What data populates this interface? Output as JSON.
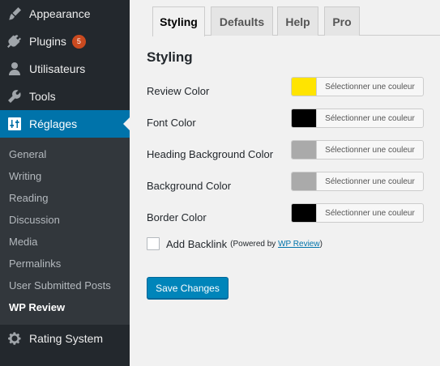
{
  "sidebar": {
    "menu_top": [
      {
        "label": "Appearance",
        "icon": "paintbrush-icon"
      },
      {
        "label": "Plugins",
        "icon": "plug-icon",
        "badge": "5"
      },
      {
        "label": "Utilisateurs",
        "icon": "user-icon"
      },
      {
        "label": "Tools",
        "icon": "wrench-icon"
      },
      {
        "label": "Réglages",
        "icon": "settings-sliders-icon"
      }
    ],
    "submenu": [
      "General",
      "Writing",
      "Reading",
      "Discussion",
      "Media",
      "Permalinks",
      "User Submitted Posts",
      "WP Review"
    ],
    "menu_bottom": [
      {
        "label": "Rating System",
        "icon": "gear-icon"
      }
    ]
  },
  "tabs": [
    "Styling",
    "Defaults",
    "Help",
    "Pro"
  ],
  "section_title": "Styling",
  "color_button_label": "Sélectionner une couleur",
  "rows": [
    {
      "label": "Review Color",
      "color": "#ffe400"
    },
    {
      "label": "Font Color",
      "color": "#000000"
    },
    {
      "label": "Heading Background Color",
      "color": "#aaaaaa"
    },
    {
      "label": "Background Color",
      "color": "#aaaaaa"
    },
    {
      "label": "Border Color",
      "color": "#000000"
    }
  ],
  "backlink": {
    "label": "Add Backlink",
    "powered_prefix": "(Powered by ",
    "powered_link": "WP Review",
    "powered_suffix": ")"
  },
  "save_button": "Save Changes",
  "colors": {
    "sidebar_bg": "#23282d",
    "accent": "#0073aa",
    "badge": "#ca4a1f",
    "button": "#0085ba"
  }
}
